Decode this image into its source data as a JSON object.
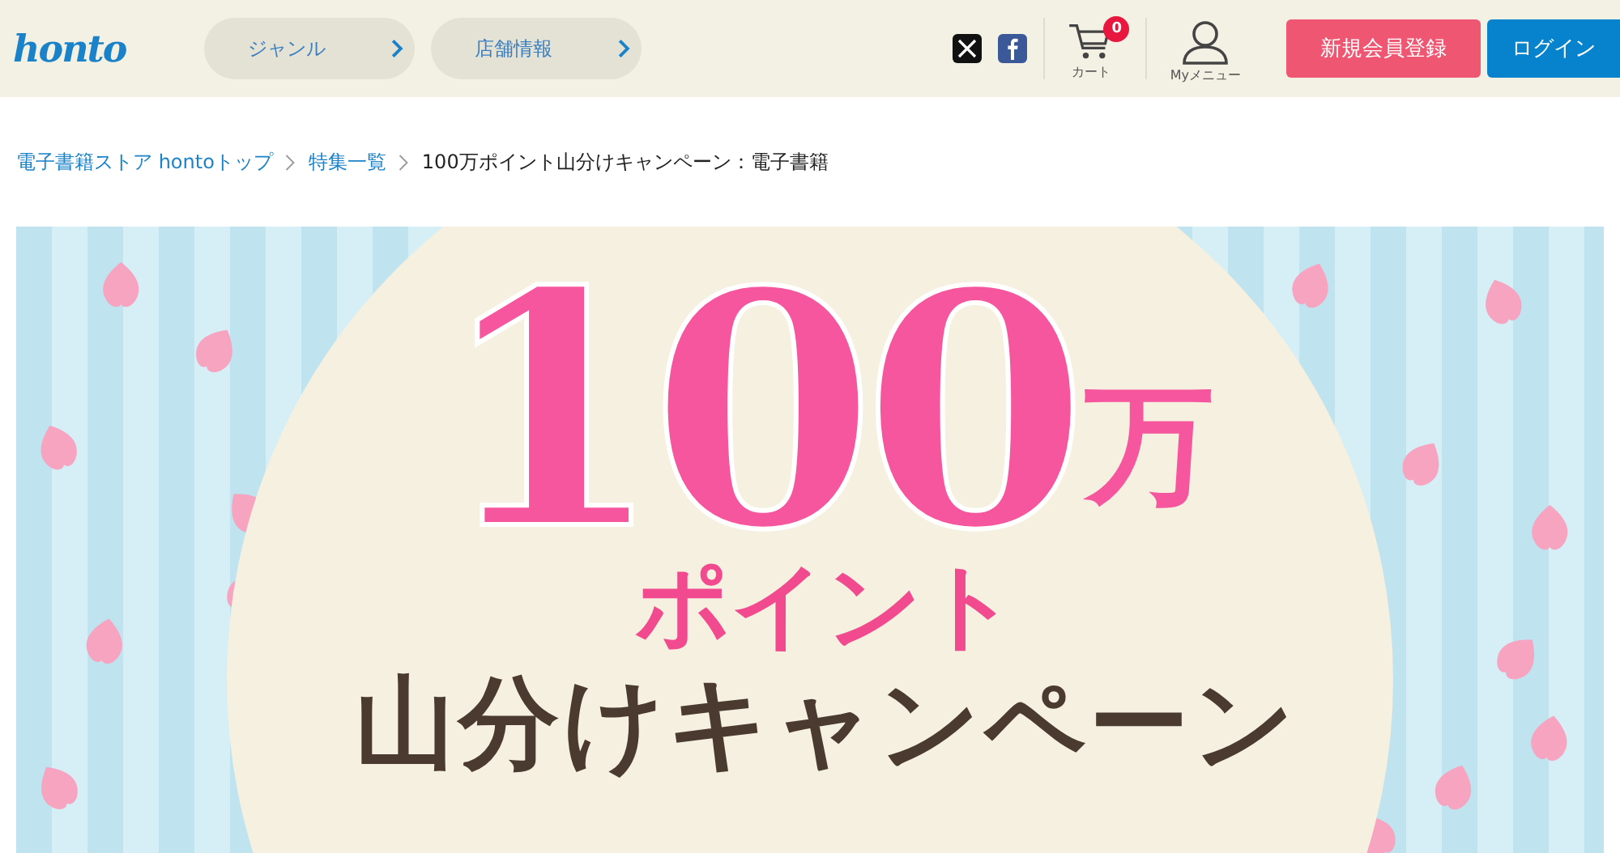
{
  "header": {
    "logo": "honto",
    "nav": [
      {
        "label": "ジャンル"
      },
      {
        "label": "店舗情報"
      }
    ],
    "cart": {
      "label": "カート",
      "count": "0"
    },
    "my_menu": {
      "label": "Myメニュー"
    },
    "register_button": "新規会員登録",
    "login_button": "ログイン"
  },
  "breadcrumb": [
    "電子書籍ストア hontoトップ",
    "特集一覧",
    "100万ポイント山分けキャンペーン：電子書籍"
  ],
  "banner": {
    "amount": "100",
    "unit": "万",
    "points": "ポイント",
    "campaign": "山分けキャンペーン"
  }
}
